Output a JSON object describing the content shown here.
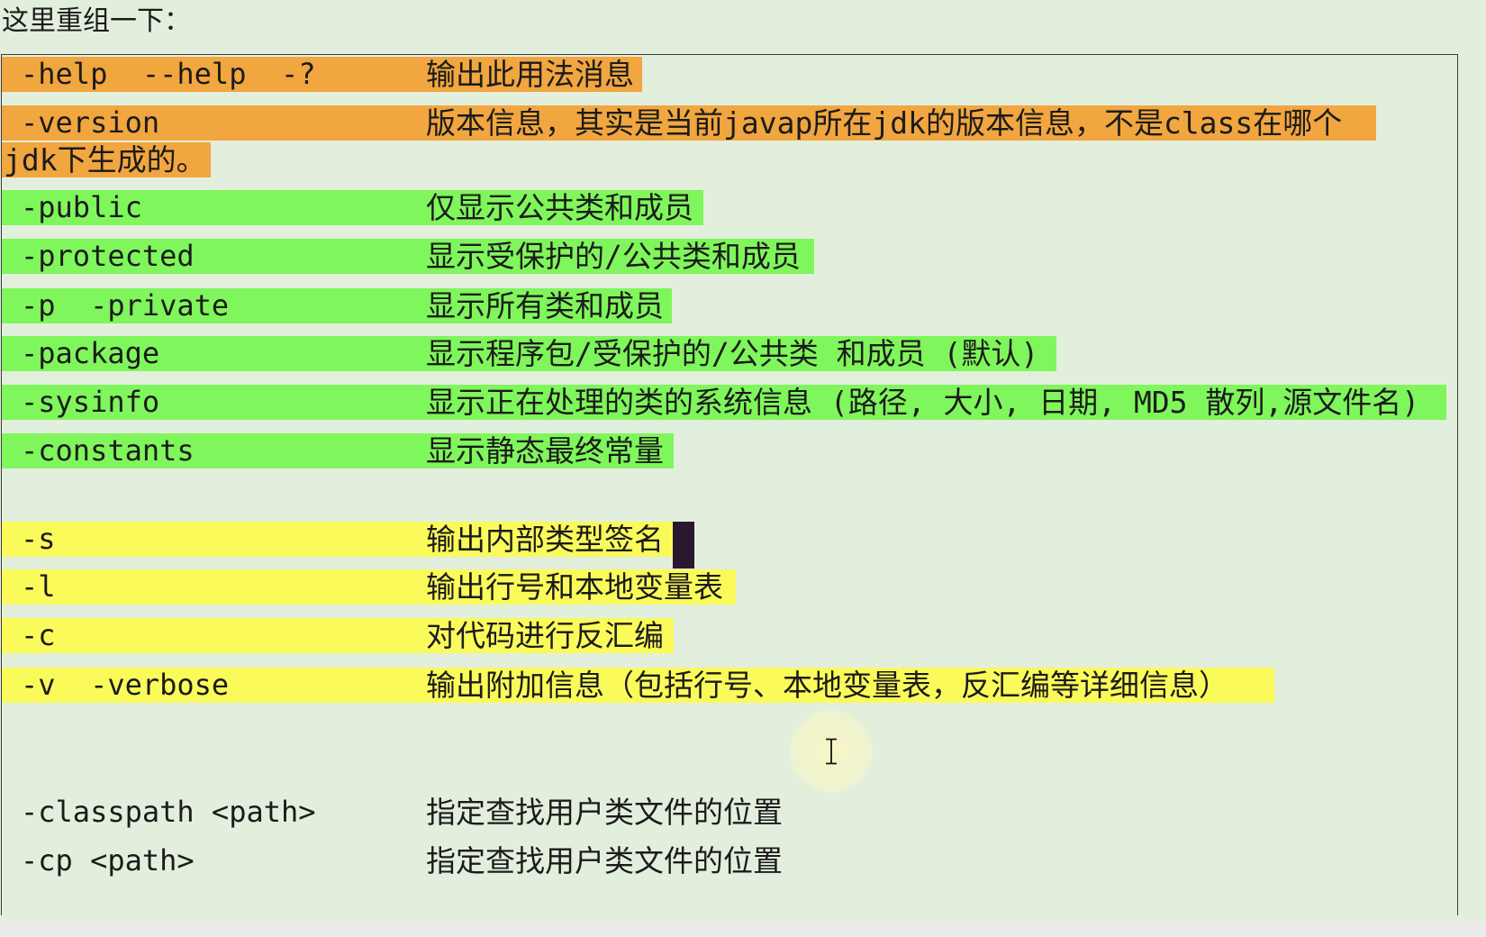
{
  "title": "这里重组一下：",
  "colors": {
    "background": "#e3efdd",
    "text": "#1b1b1b",
    "orange_highlight": "#f1a63f",
    "green_highlight": "#7ff65b",
    "yellow_highlight": "#fafa5b",
    "caret": "#2a1830"
  },
  "rows": [
    {
      "option": "-help  --help  -?",
      "description": "输出此用法消息",
      "highlight": "orange"
    },
    {
      "option": "-version",
      "description": "版本信息，其实是当前javap所在jdk的版本信息，不是class在哪个",
      "description_cont": "jdk下生成的。",
      "highlight": "orange"
    },
    {
      "option": "-public",
      "description": "仅显示公共类和成员",
      "highlight": "green"
    },
    {
      "option": "-protected",
      "description": "显示受保护的/公共类和成员",
      "highlight": "green"
    },
    {
      "option": "-p  -private",
      "description": "显示所有类和成员",
      "highlight": "green"
    },
    {
      "option": "-package",
      "description": "显示程序包/受保护的/公共类 和成员 (默认)",
      "highlight": "green"
    },
    {
      "option": "-sysinfo",
      "description": "显示正在处理的类的系统信息 (路径, 大小, 日期, MD5 散列,源文件名)",
      "highlight": "green"
    },
    {
      "option": "-constants",
      "description": "显示静态最终常量",
      "highlight": "green"
    },
    {
      "option": "-s",
      "description": "输出内部类型签名",
      "highlight": "yellow"
    },
    {
      "option": "-l",
      "description": "输出行号和本地变量表",
      "highlight": "yellow"
    },
    {
      "option": "-c",
      "description": "对代码进行反汇编",
      "highlight": "yellow"
    },
    {
      "option": "-v  -verbose",
      "description": "输出附加信息（包括行号、本地变量表，反汇编等详细信息）",
      "highlight": "yellow"
    },
    {
      "option": "-classpath <path>",
      "description": "指定查找用户类文件的位置",
      "highlight": "none"
    },
    {
      "option": "-cp <path>",
      "description": "指定查找用户类文件的位置",
      "highlight": "none"
    }
  ],
  "icons": {
    "mouse_cursor": "i-beam-cursor-icon",
    "text_caret": "block-caret"
  }
}
